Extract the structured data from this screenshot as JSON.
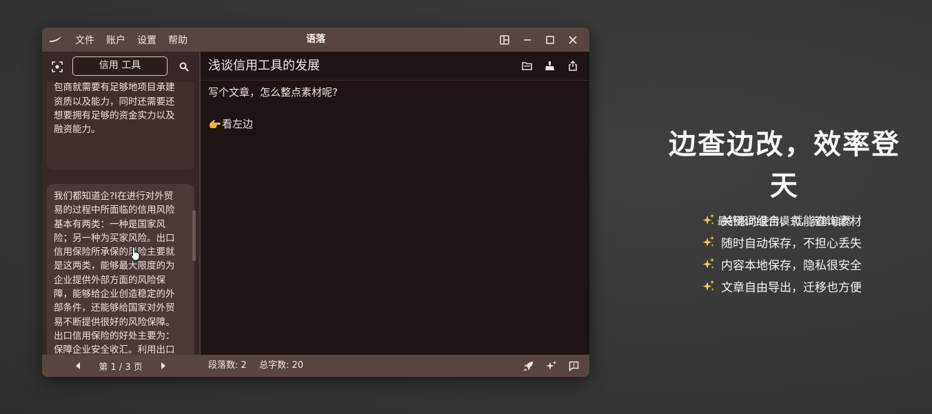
{
  "window": {
    "title": "语落",
    "menu": [
      "文件",
      "账户",
      "设置",
      "帮助"
    ]
  },
  "sidebar": {
    "search_value": "信用 工具",
    "cards": [
      {
        "text": "想要参与到国际竞争中去，承\n包商就需要有足够地项目承建\n资质以及能力，同时还需要还\n想要拥有足够的资金实力以及\n融资能力。"
      },
      {
        "text": "我们都知道企?I在进行对外贸\n易的过程中所面临的信用风险\n基本有两类：一种是国家风\n险；另一种为买家风险。出口\n信用保险所承保的风险主要就\n是这两类，能够最大限度的为\n企业提供外部方面的风险保\n障，能够给企业创造稳定的外\n部条件，还能够给国家对外贸\n易不断提供很好的风险保障。\n出口信用保险的好处主要为：\n保障企业安全收汇。利用出口\n信用保险，企业可以采取便捷\n的结算方式，得到更好的贸易"
      }
    ],
    "pager": {
      "text": "第 1 / 3 页"
    }
  },
  "document": {
    "title": "浅谈信用工具的发展",
    "paragraphs": [
      "写个文章，怎么整点素材呢?",
      "看左边"
    ]
  },
  "status": {
    "paragraphs": "段落数: 2",
    "chars": "总字数: 20"
  },
  "promo": {
    "title": "边查边改，效率登天",
    "subtitle": "最舒服的使用模式，简单自然",
    "features": [
      "关键词组合，就能查询素材",
      "随时自动保存，不担心丢失",
      "内容本地保存，隐私很安全",
      "文章自由导出，迁移也方便"
    ]
  },
  "colors": {
    "titlebar": "#574542",
    "editor_bg": "#1e1414",
    "sidebar_bg": "#352826",
    "card_bg": "#4a3a37",
    "search_border": "#e2c9c1"
  }
}
